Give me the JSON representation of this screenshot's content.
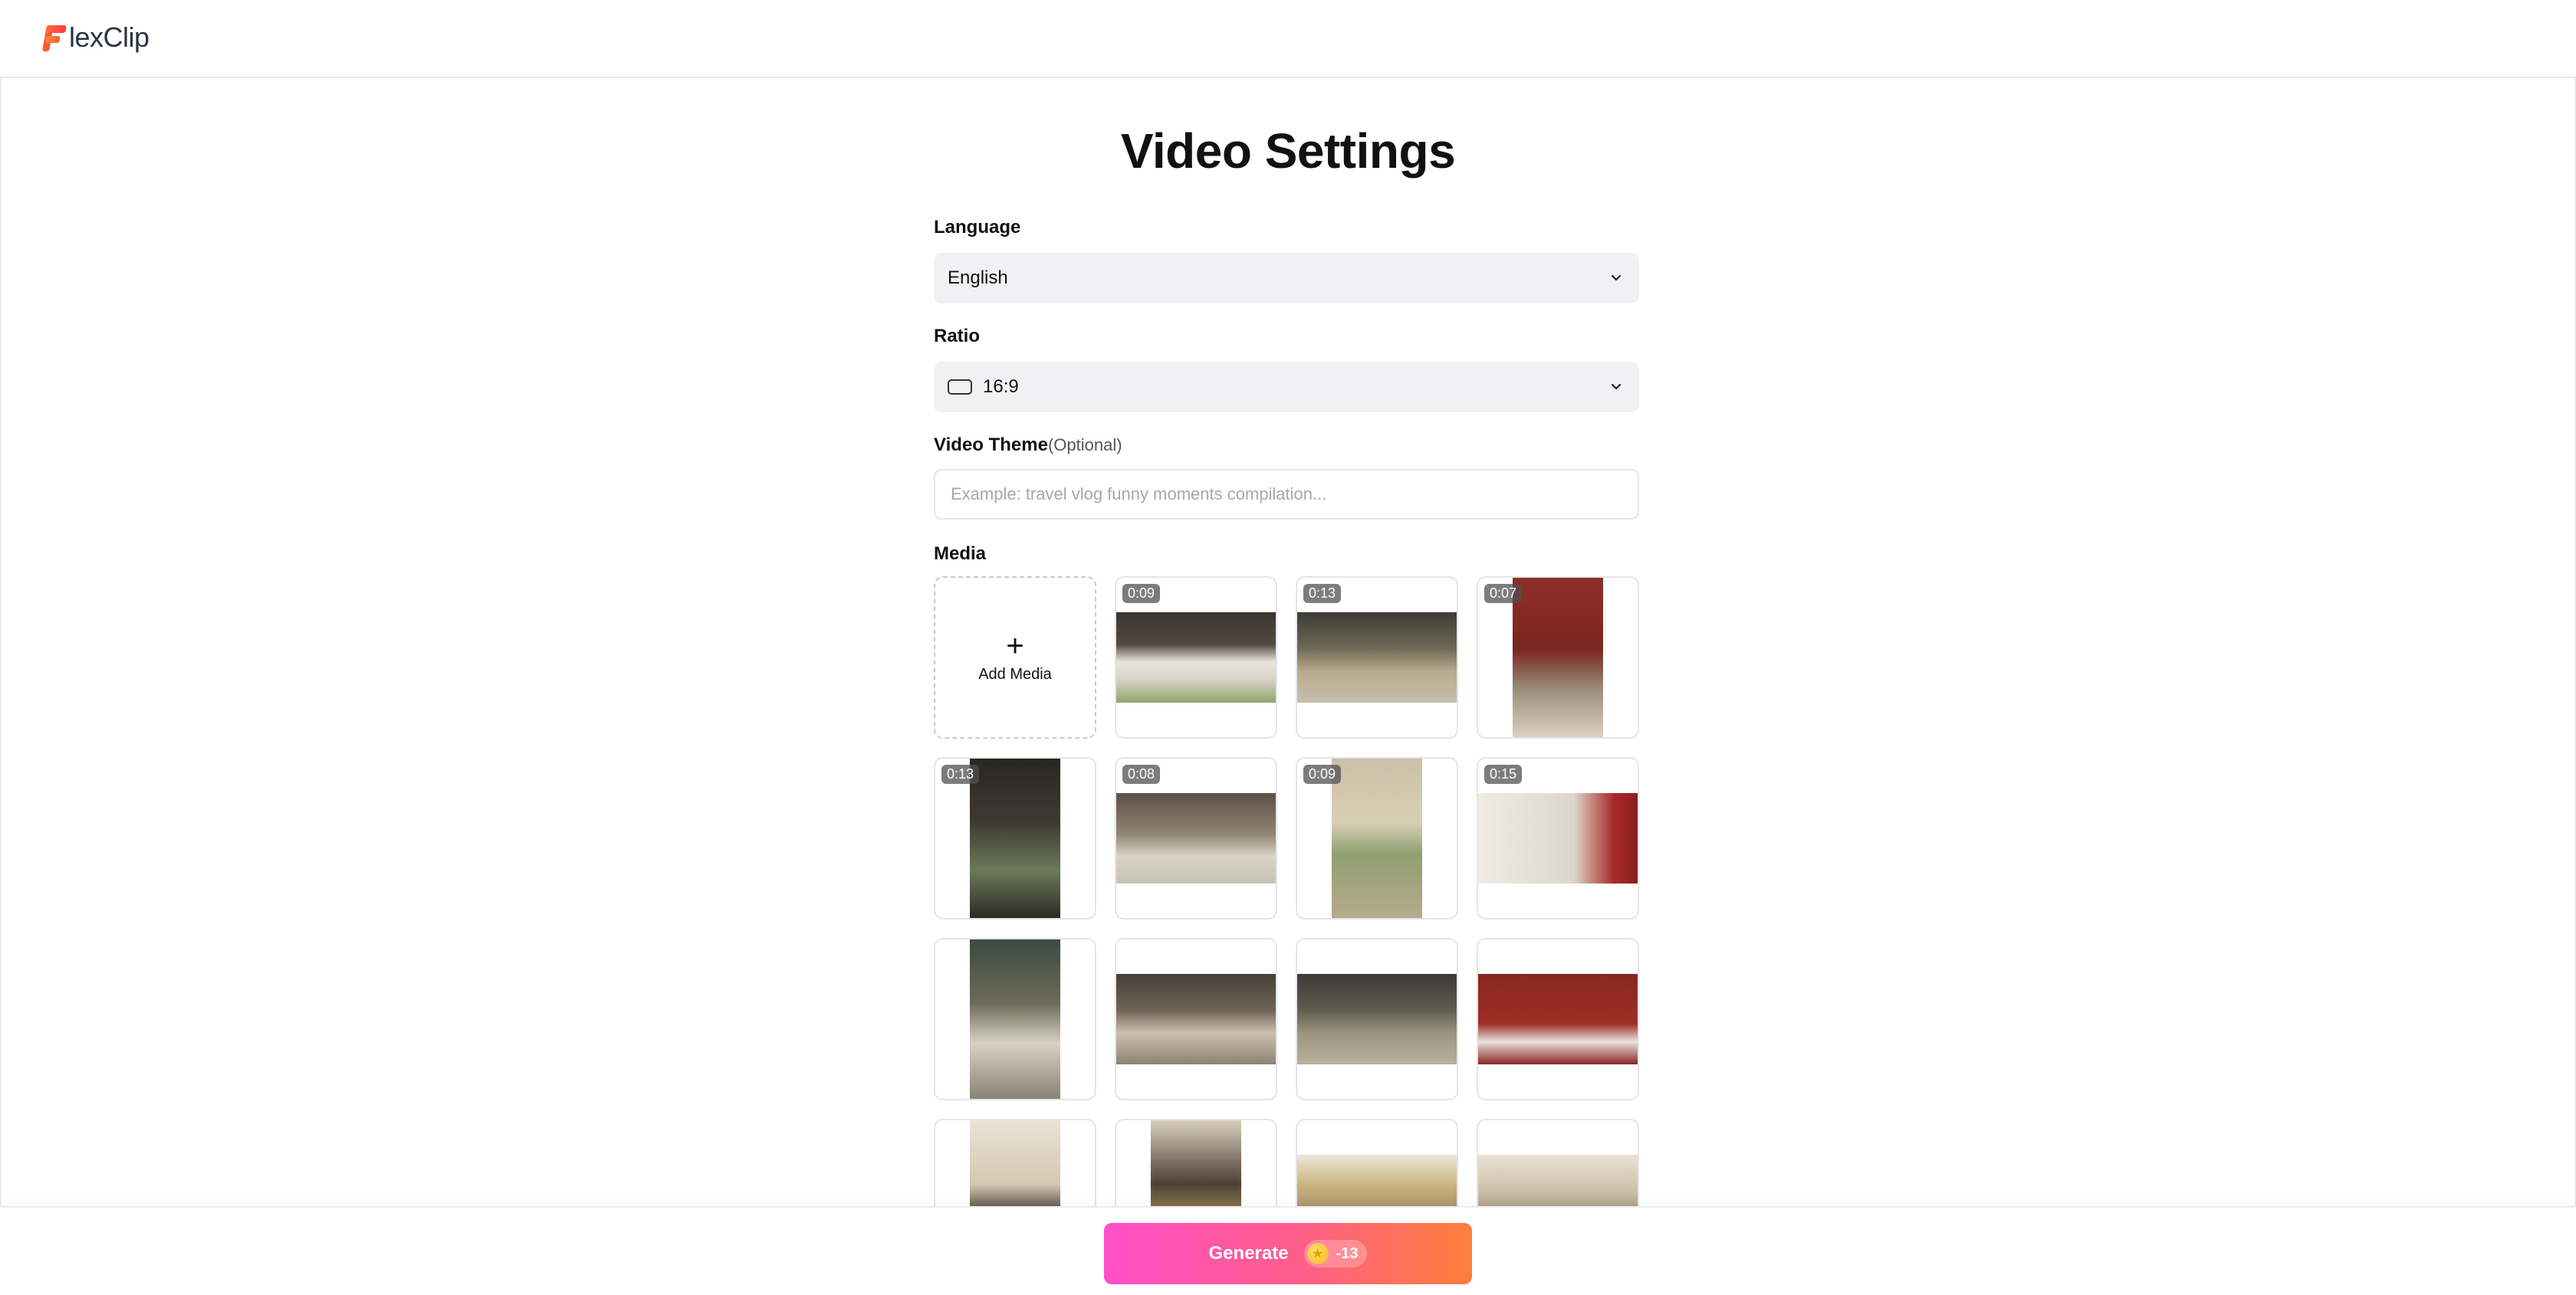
{
  "app": {
    "logo_text": "lexClip",
    "logo_aria": "FlexClip"
  },
  "page": {
    "title": "Video Settings"
  },
  "form": {
    "language": {
      "label": "Language",
      "value": "English"
    },
    "ratio": {
      "label": "Ratio",
      "value": "16:9"
    },
    "theme": {
      "label": "Video Theme",
      "optional": "(Optional)",
      "placeholder": "Example: travel vlog funny moments compilation..."
    },
    "media": {
      "label": "Media",
      "add_label": "Add Media",
      "items": [
        {
          "duration": "0:09",
          "orientation": "landscape",
          "scene": "kitchen-bunting"
        },
        {
          "duration": "0:13",
          "orientation": "landscape",
          "scene": "sofa-kids"
        },
        {
          "duration": "0:07",
          "orientation": "portrait",
          "scene": "red-wall-table"
        },
        {
          "duration": "0:13",
          "orientation": "portrait",
          "scene": "girl-chair"
        },
        {
          "duration": "0:08",
          "orientation": "landscape",
          "scene": "kids-dancing"
        },
        {
          "duration": "0:09",
          "orientation": "portrait",
          "scene": "girl-gift"
        },
        {
          "duration": "0:15",
          "orientation": "landscape",
          "scene": "kids-kitchen"
        },
        {
          "duration": "",
          "orientation": "portrait",
          "scene": "kids-hug"
        },
        {
          "duration": "",
          "orientation": "landscape",
          "scene": "family-group"
        },
        {
          "duration": "",
          "orientation": "landscape",
          "scene": "sofa-group"
        },
        {
          "duration": "",
          "orientation": "landscape",
          "scene": "red-gifts"
        },
        {
          "duration": "",
          "orientation": "portrait",
          "scene": "shelf-banner"
        },
        {
          "duration": "",
          "orientation": "portrait",
          "scene": "banner-kid"
        },
        {
          "duration": "",
          "orientation": "landscape",
          "scene": "kids-hats"
        },
        {
          "duration": "",
          "orientation": "landscape",
          "scene": "girls-party"
        }
      ]
    }
  },
  "footer": {
    "generate_label": "Generate",
    "cost": "-13"
  },
  "colors": {
    "accent_start": "#ff4fc8",
    "accent_end": "#ff7f3a",
    "field_bg": "#f1f1f4"
  }
}
